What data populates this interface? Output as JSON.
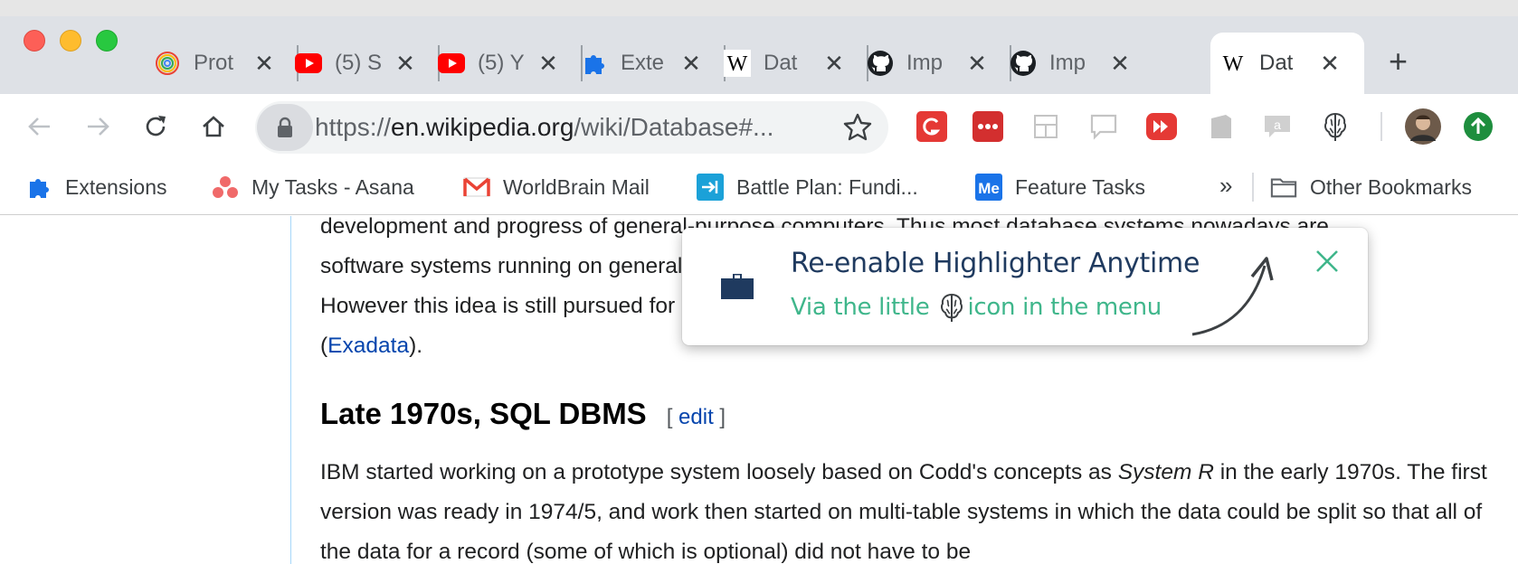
{
  "tabs": [
    {
      "title": "Prot",
      "favicon": "chrome-circle-icon"
    },
    {
      "title": "(5) S",
      "favicon": "youtube-icon"
    },
    {
      "title": "(5) Y",
      "favicon": "youtube-icon"
    },
    {
      "title": "Exte",
      "favicon": "puzzle-icon"
    },
    {
      "title": "Dat",
      "favicon": "wikipedia-icon"
    },
    {
      "title": "Imp",
      "favicon": "github-icon"
    },
    {
      "title": "Imp",
      "favicon": "github-icon"
    },
    {
      "title": "Dat",
      "favicon": "wikipedia-icon",
      "active": true
    }
  ],
  "toolbar": {
    "url_scheme": "https://",
    "url_host": "en.wikipedia.org",
    "url_path": "/wiki/Database#..."
  },
  "bookmarks": {
    "items": [
      {
        "label": "Extensions",
        "icon": "puzzle-icon"
      },
      {
        "label": "My Tasks - Asana",
        "icon": "asana-icon"
      },
      {
        "label": "WorldBrain Mail",
        "icon": "gmail-icon"
      },
      {
        "label": "Battle Plan: Fundi...",
        "icon": "battle-plan-icon"
      },
      {
        "label": "Feature Tasks",
        "icon": "me-icon"
      }
    ],
    "overflow": "»",
    "other": "Other Bookmarks"
  },
  "article": {
    "line1": "development and progress of general-purpose computers. Thus most database systems nowadays are",
    "line2": "software systems running on general-purpose hardware, using general-purpose computer data storage.",
    "line3": "However this idea is still pursued for certain applications by some companies like Netezza and Oracle",
    "line4_open": "(",
    "line4_link": "Exadata",
    "line4_close": ").",
    "heading": "Late 1970s, SQL DBMS",
    "edit_open": "[ ",
    "edit_link": "edit",
    "edit_close": " ]",
    "p2_a": "IBM started working on a prototype system loosely based on Codd's concepts as ",
    "p2_em": "System R",
    "p2_b": " in the early 1970s. The first version was ready in 1974/5, and work then started on multi-table systems in which the data could be split so that all of the data for a record (some of which is optional) did not have to be"
  },
  "popup": {
    "title": "Re-enable Highlighter Anytime",
    "sub_before": "Via the little",
    "sub_after": "icon in the menu"
  },
  "colors": {
    "popup_title": "#1f3a5f",
    "popup_accent": "#3fb68b",
    "wiki_link": "#0645ad"
  }
}
